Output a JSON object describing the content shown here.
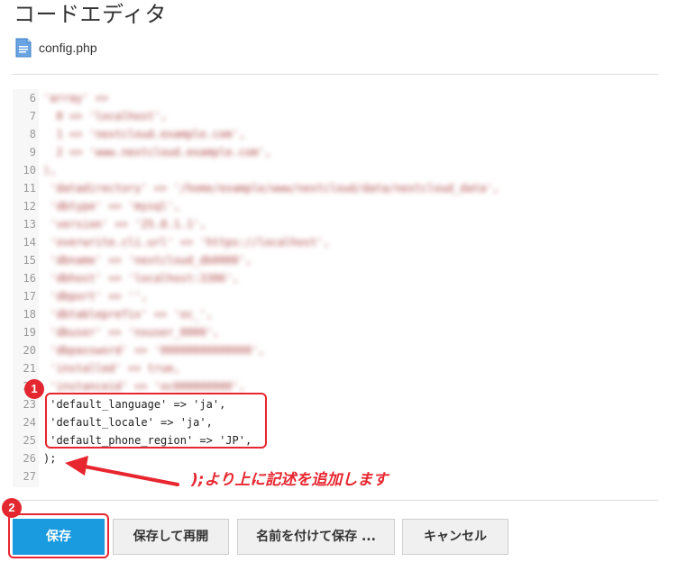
{
  "header": {
    "title": "コードエディタ"
  },
  "file": {
    "name": "config.php",
    "icon": "file-icon"
  },
  "editor": {
    "lines": [
      {
        "num": "6",
        "code": "'array' => ",
        "blurred": true
      },
      {
        "num": "7",
        "code": "  0 => 'localhost',",
        "blurred": true
      },
      {
        "num": "8",
        "code": "  1 => 'nextcloud.example.com',",
        "blurred": true
      },
      {
        "num": "9",
        "code": "  2 => 'www.nextcloud.example.com',",
        "blurred": true
      },
      {
        "num": "10",
        "code": "),",
        "blurred": true
      },
      {
        "num": "11",
        "code": " 'datadirectory' => '/home/example/www/nextcloud/data/nextcloud_data',",
        "blurred": true
      },
      {
        "num": "12",
        "code": " 'dbtype' => 'mysql',",
        "blurred": true
      },
      {
        "num": "13",
        "code": " 'version' => '25.0.1.1',",
        "blurred": true
      },
      {
        "num": "14",
        "code": " 'overwrite.cli.url' => 'https://localhost',",
        "blurred": true
      },
      {
        "num": "15",
        "code": " 'dbname' => 'nextcloud_db0000',",
        "blurred": true
      },
      {
        "num": "16",
        "code": " 'dbhost' => 'localhost:3306',",
        "blurred": true
      },
      {
        "num": "17",
        "code": " 'dbport' => '',",
        "blurred": true
      },
      {
        "num": "18",
        "code": " 'dbtableprefix' => 'oc_',",
        "blurred": true
      },
      {
        "num": "19",
        "code": " 'dbuser' => 'nxuser_0000',",
        "blurred": true
      },
      {
        "num": "20",
        "code": " 'dbpassword' => '00000000000000',",
        "blurred": true
      },
      {
        "num": "21",
        "code": " 'installed' => true,",
        "blurred": true
      },
      {
        "num": "22",
        "code": " 'instanceid' => 'oc000000000',",
        "blurred": true
      },
      {
        "num": "23",
        "code": " 'default_language' => 'ja',",
        "blurred": false
      },
      {
        "num": "24",
        "code": " 'default_locale' => 'ja',",
        "blurred": false
      },
      {
        "num": "25",
        "code": " 'default_phone_region' => 'JP',",
        "blurred": false
      },
      {
        "num": "26",
        "code": ");",
        "blurred": false
      },
      {
        "num": "27",
        "code": "",
        "blurred": false
      }
    ]
  },
  "annotations": {
    "badge1": "1",
    "badge2": "2",
    "note": ");より上に記述を追加します"
  },
  "buttons": {
    "save": "保存",
    "save_reopen": "保存して再開",
    "save_as": "名前を付けて保存 ...",
    "cancel": "キャンセル"
  },
  "colors": {
    "primary": "#1a9be0",
    "annotation_red": "#e8262f"
  }
}
